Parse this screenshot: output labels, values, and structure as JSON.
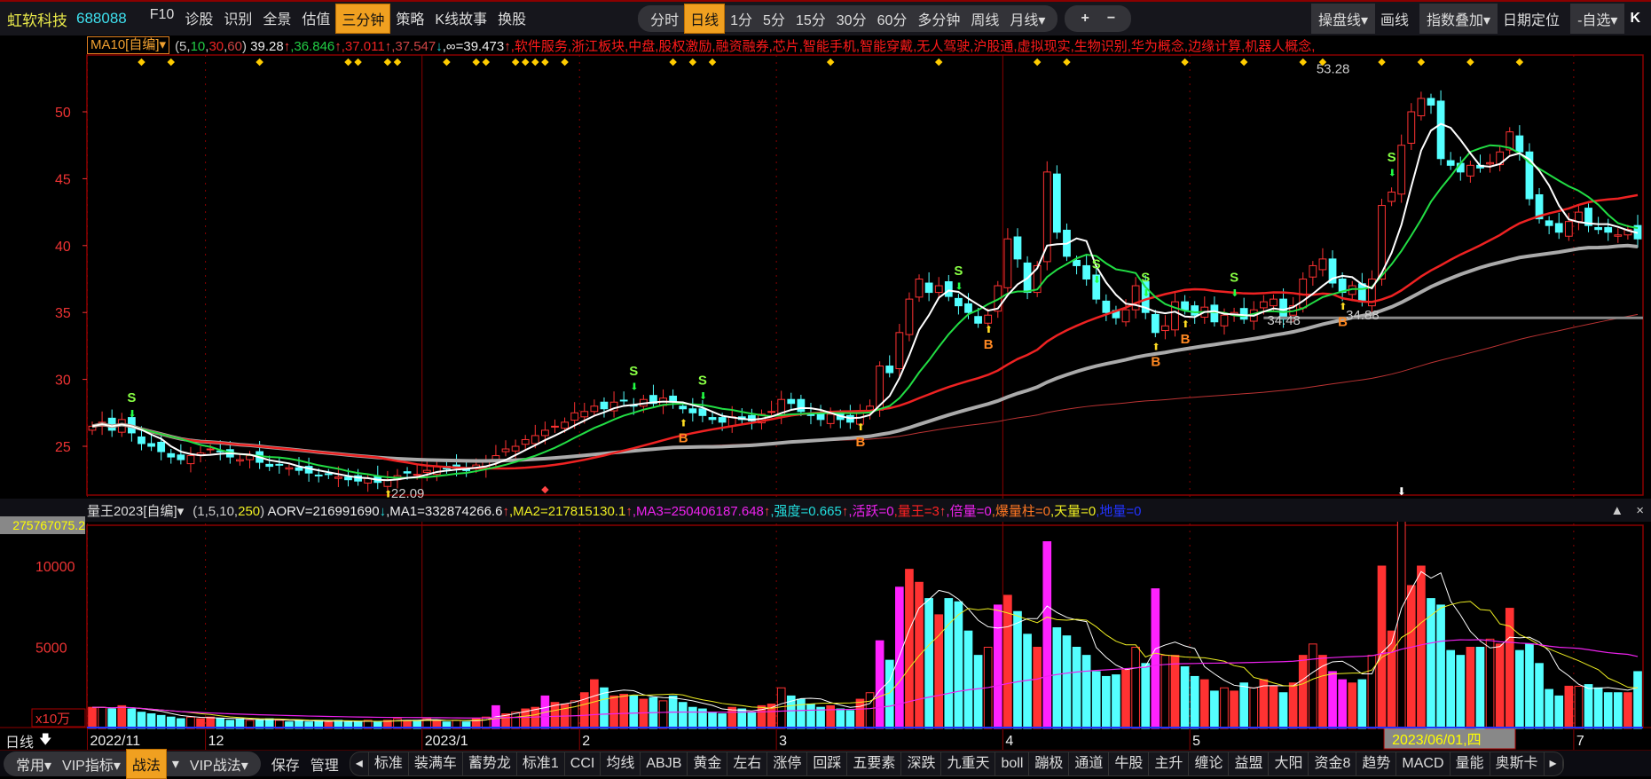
{
  "header": {
    "stock_name": "虹软科技",
    "stock_code": "688088",
    "menu": [
      "F10",
      "诊股",
      "识别",
      "全景",
      "估值",
      "三分钟",
      "策略",
      "K线故事",
      "换股"
    ],
    "menu_active": "三分钟",
    "periods": [
      "分时",
      "日线",
      "1分",
      "5分",
      "15分",
      "30分",
      "60分",
      "多分钟",
      "周线",
      "月线▾"
    ],
    "period_active": "日线",
    "zoom": [
      "+",
      "−"
    ],
    "right": [
      {
        "label": "操盘线▾",
        "boxed": true
      },
      {
        "label": "画线",
        "boxed": false
      },
      {
        "label": "指数叠加▾",
        "boxed": true
      },
      {
        "label": "日期定位",
        "boxed": false
      },
      {
        "label": "-自选▾",
        "boxed": true
      },
      {
        "label": "K",
        "boxed": false
      }
    ]
  },
  "ma_row": {
    "indicator": "MA10[自编]▾",
    "segments": [
      {
        "t": "(5,",
        "c": "#cccccc"
      },
      {
        "t": "10",
        "c": "#22cc44"
      },
      {
        "t": ",",
        "c": "#cccccc"
      },
      {
        "t": "30",
        "c": "#ee2222"
      },
      {
        "t": ",",
        "c": "#cccccc"
      },
      {
        "t": "60",
        "c": "#cc4444"
      },
      {
        "t": ") ",
        "c": "#cccccc"
      },
      {
        "t": "39.28",
        "c": "#eeeeee"
      },
      {
        "t": "↑",
        "c": "#ff4444"
      },
      {
        "t": ",36.846",
        "c": "#22cc44"
      },
      {
        "t": "↑",
        "c": "#ff4444"
      },
      {
        "t": ",37.011",
        "c": "#ee2222"
      },
      {
        "t": "↑",
        "c": "#ff4444"
      },
      {
        "t": ",37.547",
        "c": "#cc4444"
      },
      {
        "t": "↓",
        "c": "#22dddd"
      },
      {
        "t": ",∞=39.473",
        "c": "#eeeeee"
      },
      {
        "t": "↑",
        "c": "#ff4444"
      },
      {
        "t": ",软件服务,浙江板块,中盘,股权激励,融资融券,芯片,智能手机,智能穿戴,无人驾驶,沪股通,虚拟现实,生物识别,华为概念,边缘计算,机器人概念,",
        "c": "#ff1a1a"
      }
    ]
  },
  "indicator_row": {
    "name": "量王2023[自编]▾",
    "segments": [
      {
        "t": "(1,5,10,",
        "c": "#cccccc"
      },
      {
        "t": "250",
        "c": "#eeee22"
      },
      {
        "t": ")  ",
        "c": "#cccccc"
      },
      {
        "t": "AORV=216991690",
        "c": "#eeeeee"
      },
      {
        "t": "↓",
        "c": "#22dddd"
      },
      {
        "t": ",MA1=332874266.6",
        "c": "#eeeeee"
      },
      {
        "t": "↑",
        "c": "#ff4444"
      },
      {
        "t": ",MA2=217815130.1",
        "c": "#eeee22"
      },
      {
        "t": "↑",
        "c": "#ff4444"
      },
      {
        "t": ",MA3=250406187.648",
        "c": "#ee22ee"
      },
      {
        "t": "↑",
        "c": "#ff4444"
      },
      {
        "t": ",强度=0.665",
        "c": "#22dddd"
      },
      {
        "t": "↑",
        "c": "#ff4444"
      },
      {
        "t": ",活跃=0",
        "c": "#ee22ee"
      },
      {
        "t": ",量王=3",
        "c": "#ff2222"
      },
      {
        "t": "↑",
        "c": "#ff4444"
      },
      {
        "t": ",倍量=0",
        "c": "#ee22ee"
      },
      {
        "t": ",爆量柱=0",
        "c": "#ff7722"
      },
      {
        "t": ",天量=0",
        "c": "#eeee22"
      },
      {
        "t": ",地量=0",
        "c": "#2233ff"
      }
    ],
    "readout": "275767075.2",
    "unit": "x10万",
    "controls": [
      "▲",
      "×"
    ]
  },
  "axis": {
    "period_label": "日线",
    "period_icon": "arrow-down-icon",
    "selected_date": "2023/06/01,四"
  },
  "bottom": {
    "groups": [
      {
        "label": "常用▾",
        "active": false
      },
      {
        "label": "VIP指标▾",
        "active": false
      },
      {
        "label": "战法",
        "active": true
      },
      {
        "label": "▾",
        "active": false
      },
      {
        "label": "VIP战法▾",
        "active": false
      }
    ],
    "actions": [
      "保存",
      "管理"
    ],
    "tabs": [
      "◂",
      "标准",
      "装满车",
      "蓄势龙",
      "标准1",
      "CCI",
      "均线",
      "ABJB",
      "黄金",
      "左右",
      "涨停",
      "回踩",
      "五要素",
      "深跌",
      "九重天",
      "boll",
      "蹦极",
      "通道",
      "牛股",
      "主升",
      "缠论",
      "益盟",
      "大阳",
      "资金8",
      "趋势",
      "MACD",
      "量能",
      "奥斯卡",
      "▸"
    ]
  },
  "colors": {
    "up": "#ff3232",
    "down": "#54ffff",
    "ma5": "#ffffff",
    "ma10": "#22dd44",
    "ma30": "#ee2222",
    "ma60": "#aaaaaa",
    "ma120": "#bb3333",
    "vol_king": "#ff22ff",
    "grid": "#8b0000",
    "diamond": "#ffcc00"
  },
  "chart_data": [
    {
      "type": "candlestick",
      "yticks": [
        25,
        30,
        35,
        40,
        45,
        50
      ],
      "ylim": [
        20.8,
        53.8
      ],
      "month_labels": [
        {
          "i": 0,
          "label": "2022/11"
        },
        {
          "i": 12,
          "label": "12"
        },
        {
          "i": 34,
          "label": "2023/1"
        },
        {
          "i": 50,
          "label": "2"
        },
        {
          "i": 70,
          "label": "3"
        },
        {
          "i": 93,
          "label": "4"
        },
        {
          "i": 112,
          "label": "5"
        },
        {
          "i": 151,
          "label": "7"
        }
      ],
      "selected_index": 132,
      "close": [
        26.5,
        26.8,
        26.2,
        27.0,
        26.0,
        25.2,
        25.0,
        24.6,
        24.2,
        24.0,
        24.3,
        24.5,
        24.8,
        24.6,
        24.2,
        24.0,
        24.3,
        23.8,
        23.5,
        23.6,
        23.4,
        23.2,
        23.0,
        22.8,
        22.9,
        22.7,
        22.5,
        22.4,
        22.6,
        22.3,
        22.5,
        22.8,
        23.0,
        22.9,
        23.2,
        23.5,
        23.3,
        23.4,
        23.2,
        23.6,
        24.0,
        24.3,
        24.8,
        25.0,
        25.5,
        25.8,
        26.2,
        26.5,
        26.8,
        27.5,
        27.6,
        28.0,
        27.8,
        28.3,
        28.4,
        28.0,
        28.5,
        28.2,
        28.6,
        28.3,
        27.8,
        27.5,
        27.3,
        27.0,
        26.8,
        27.2,
        27.0,
        26.9,
        27.4,
        27.6,
        28.5,
        28.2,
        27.6,
        27.3,
        27.0,
        27.4,
        27.0,
        26.8,
        27.5,
        28.0,
        31.0,
        30.5,
        33.5,
        36.0,
        37.5,
        36.5,
        37.0,
        36.2,
        35.5,
        35.0,
        34.2,
        34.8,
        37.0,
        40.5,
        39.0,
        36.5,
        38.5,
        45.5,
        41.0,
        39.2,
        38.5,
        37.5,
        36.0,
        35.0,
        34.6,
        35.2,
        37.0,
        35.0,
        33.5,
        34.0,
        35.8,
        35.2,
        34.8,
        35.4,
        34.3,
        34.8,
        35.0,
        34.5,
        35.2,
        35.8,
        36.0,
        34.5,
        35.5,
        37.5,
        38.5,
        39.0,
        37.2,
        36.5,
        37.0,
        35.8,
        37.5,
        43.0,
        44.0,
        47.5,
        50.0,
        51.0,
        50.5,
        46.5,
        46.0,
        45.5,
        46.0,
        45.8,
        46.2,
        47.0,
        48.5,
        47.0,
        43.5,
        42.0,
        41.5,
        41.0,
        41.8,
        42.5,
        41.5,
        41.2,
        41.0,
        40.8,
        41.2,
        40.5
      ],
      "annotations": [
        {
          "i": 30,
          "price": 22.09,
          "label": "22.09"
        },
        {
          "i": 124,
          "price": 53.28,
          "label": "53.28"
        },
        {
          "i": 119,
          "price": 34.48,
          "label": "34.48"
        },
        {
          "i": 127,
          "price": 34.88,
          "label": "34.88"
        }
      ],
      "signals": [
        {
          "i": 4,
          "t": "S"
        },
        {
          "i": 30,
          "t": "B"
        },
        {
          "i": 55,
          "t": "S"
        },
        {
          "i": 60,
          "t": "B"
        },
        {
          "i": 62,
          "t": "S"
        },
        {
          "i": 78,
          "t": "B"
        },
        {
          "i": 88,
          "t": "S"
        },
        {
          "i": 91,
          "t": "B"
        },
        {
          "i": 102,
          "t": "S"
        },
        {
          "i": 107,
          "t": "S"
        },
        {
          "i": 108,
          "t": "B"
        },
        {
          "i": 111,
          "t": "B"
        },
        {
          "i": 116,
          "t": "S"
        },
        {
          "i": 127,
          "t": "B"
        },
        {
          "i": 132,
          "t": "S"
        }
      ],
      "event_days": [
        5,
        8,
        17,
        26,
        27,
        30,
        31,
        36,
        39,
        40,
        43,
        44,
        45,
        46,
        48,
        59,
        61,
        63,
        75,
        86,
        96,
        99,
        111,
        117,
        123,
        125,
        131,
        135,
        140,
        145
      ]
    },
    {
      "type": "bar",
      "title": "量王2023",
      "yticks": [
        5000,
        10000
      ],
      "ylim": [
        0,
        14500
      ],
      "volume": [
        1300,
        1300,
        1200,
        1400,
        1200,
        1000,
        900,
        800,
        700,
        600,
        700,
        600,
        700,
        600,
        500,
        600,
        500,
        500,
        600,
        500,
        400,
        500,
        400,
        500,
        400,
        500,
        400,
        400,
        500,
        400,
        500,
        600,
        500,
        500,
        600,
        500,
        400,
        500,
        400,
        600,
        700,
        1400,
        900,
        1000,
        1200,
        1300,
        2000,
        1600,
        1500,
        1700,
        2200,
        3000,
        2500,
        2000,
        2100,
        2000,
        1800,
        1900,
        1700,
        2000,
        1600,
        1300,
        1200,
        1000,
        900,
        1300,
        1200,
        1000,
        1400,
        1500,
        2500,
        2000,
        1800,
        1500,
        1300,
        1400,
        1200,
        1100,
        1800,
        2200,
        5400,
        4200,
        8700,
        9800,
        9000,
        8000,
        7000,
        8000,
        7800,
        6000,
        4500,
        5000,
        7600,
        8200,
        7200,
        5800,
        5000,
        11500,
        6200,
        5700,
        5000,
        4500,
        3500,
        3200,
        3300,
        3600,
        5000,
        4000,
        8600,
        4500,
        4500,
        3800,
        3200,
        3000,
        2300,
        2500,
        2300,
        2800,
        2500,
        3000,
        2600,
        2200,
        2800,
        4500,
        5200,
        4500,
        3500,
        3000,
        2800,
        3000,
        4500,
        10000,
        6000,
        13500,
        8800,
        10000,
        8000,
        7600,
        4800,
        4500,
        5000,
        5000,
        5500,
        5200,
        7400,
        4800,
        5200,
        4000,
        2400,
        2000,
        2600,
        2600,
        2700,
        2500,
        2200,
        2200,
        2200,
        3500
      ],
      "volume_king_days": [
        41,
        46,
        80,
        82,
        92,
        97,
        108,
        126,
        127
      ]
    }
  ]
}
